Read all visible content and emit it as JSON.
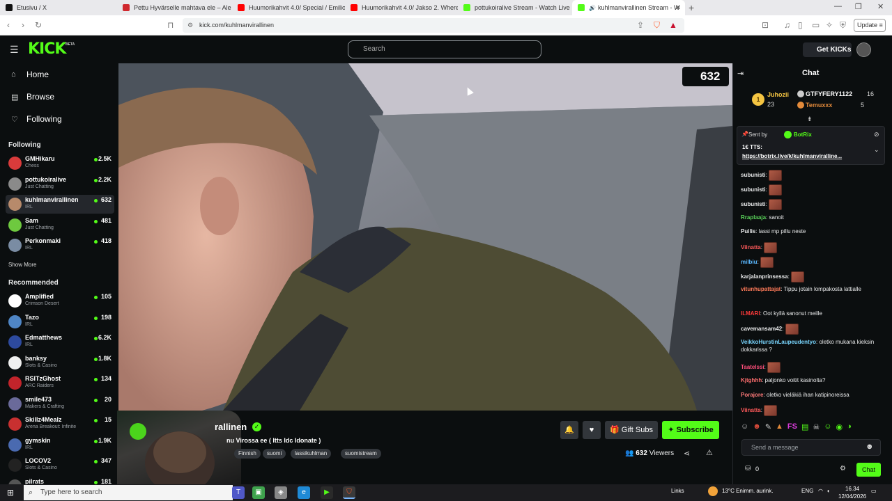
{
  "browser": {
    "tabs": [
      {
        "label": "Etusivu / X",
        "color": "#111111"
      },
      {
        "label": "Pettu Hyvärselle mahtava ele – Ale",
        "color": "#d0282e"
      },
      {
        "label": "Huumorikahvit 4.0/ Special / Emilio",
        "color": "#ff0000"
      },
      {
        "label": "Huumorikahvit 4.0/ Jakso 2. Where",
        "color": "#ff0000"
      },
      {
        "label": "pottukoiralive Stream - Watch Live o",
        "color": "#53fc18"
      },
      {
        "label": "kuhlmanvirallinen Stream - W",
        "color": "#53fc18"
      }
    ],
    "url": "kick.com/kuhlmanvirallinen",
    "update_label": "Update"
  },
  "header": {
    "logo": "KICK",
    "beta": "BETA",
    "search_placeholder": "Search",
    "get_kicks": "Get KICKs"
  },
  "sidebar": {
    "nav": [
      {
        "label": "Home",
        "icon": "home-icon"
      },
      {
        "label": "Browse",
        "icon": "browse-icon"
      },
      {
        "label": "Following",
        "icon": "heart-icon"
      }
    ],
    "following_title": "Following",
    "following": [
      {
        "name": "GMHikaru",
        "category": "Chess",
        "viewers": "2.5K",
        "color": "#d93b3b"
      },
      {
        "name": "pottukoiralive",
        "category": "Just Chatting",
        "viewers": "2.2K",
        "color": "#8a8a8a"
      },
      {
        "name": "kuhlmanvirallinen",
        "category": "IRL",
        "viewers": "632",
        "color": "#b78a6b"
      },
      {
        "name": "Sam",
        "category": "Just Chatting",
        "viewers": "481",
        "color": "#6ec93f"
      },
      {
        "name": "Perkonmaki",
        "category": "IRL",
        "viewers": "418",
        "color": "#7a8ca3"
      }
    ],
    "show_more": "Show More",
    "recommended_title": "Recommended",
    "recommended": [
      {
        "name": "Amplified",
        "category": "Crimson Desert",
        "viewers": "105",
        "color": "#ffffff"
      },
      {
        "name": "Tazo",
        "category": "IRL",
        "viewers": "198",
        "color": "#4f86c6"
      },
      {
        "name": "Edmatthews",
        "category": "IRL",
        "viewers": "6.2K",
        "color": "#2d4a9e"
      },
      {
        "name": "banksy",
        "category": "Slots & Casino",
        "viewers": "1.8K",
        "color": "#f0f0f0"
      },
      {
        "name": "RSITzGhost",
        "category": "ARC Raiders",
        "viewers": "134",
        "color": "#c2242b"
      },
      {
        "name": "smile473",
        "category": "Makers & Crafting",
        "viewers": "20",
        "color": "#6a6a9a"
      },
      {
        "name": "Skillz4Mealz",
        "category": "Arena Breakout: Infinite",
        "viewers": "15",
        "color": "#c83030"
      },
      {
        "name": "gymskin",
        "category": "IRL",
        "viewers": "1.9K",
        "color": "#4a6ab0"
      },
      {
        "name": "LOCOV2",
        "category": "Slots & Casino",
        "viewers": "347",
        "color": "#222222"
      },
      {
        "name": "pilrats",
        "category": "",
        "viewers": "181",
        "color": "#555555"
      }
    ]
  },
  "video": {
    "viewer_count": "632"
  },
  "stream": {
    "name": "rallinen",
    "title": "nu Virossa ee ( Itts Idc Idonate )",
    "tags": [
      "Finnish",
      "suomi",
      "lassikuhlman",
      "suomistream"
    ],
    "gift_subs": "Gift Subs",
    "subscribe": "Subscribe",
    "viewers": "632",
    "viewers_label": "Viewers"
  },
  "chat": {
    "title": "Chat",
    "gifters": [
      {
        "rank": "1",
        "name": "Juhozii",
        "count": "23"
      },
      {
        "name": "GTFYFERY1122",
        "count": "16"
      },
      {
        "name": "Temuxxx",
        "count": "5"
      }
    ],
    "pinned": {
      "sent_by": "Sent by",
      "bot": "BotRix",
      "tts": "1€ TTS:",
      "link": "https://botrix.live/k/kuhlmanviralline..."
    },
    "messages": [
      {
        "user": "subunisti",
        "text": "",
        "emote": true,
        "color": "#e9eaeb"
      },
      {
        "user": "subunisti",
        "text": "",
        "emote": true,
        "color": "#e9eaeb"
      },
      {
        "user": "subunisti",
        "text": "",
        "emote": true,
        "color": "#e9eaeb"
      },
      {
        "user": "Rraplaaja",
        "text": "sanoit",
        "emote": false,
        "color": "#5ad35a"
      },
      {
        "user": "Puilis",
        "text": "lassi mp pillu neste",
        "emote": false,
        "color": "#e9eaeb"
      },
      {
        "user": "Viinatta",
        "text": "",
        "emote": true,
        "color": "#ff5a5a"
      },
      {
        "user": "milbiu",
        "text": "",
        "emote": true,
        "color": "#5ab8ff"
      },
      {
        "user": "karjalanprinsessa",
        "text": "",
        "emote": true,
        "color": "#e9eaeb"
      },
      {
        "user": "vitunhupattajat",
        "text": "Tippu jotain lompakosta lattialle",
        "emote": false,
        "color": "#ff7a59"
      },
      {
        "user": "ILMARI",
        "text": "Oot kyllä sanonut meille",
        "emote": false,
        "color": "#ff3a3a"
      },
      {
        "user": "cavemansam42",
        "text": "",
        "emote": true,
        "color": "#e9eaeb"
      },
      {
        "user": "VeikkoHurstinLaupeudentyo",
        "text": "oletko mukana kieksin dokkarissa ?",
        "emote": false,
        "color": "#79d6ff"
      },
      {
        "user": "Taatelssi",
        "text": "",
        "emote": true,
        "color": "#ff4f7b"
      },
      {
        "user": "Kjtghhh",
        "text": "paljonko voitit kasinolta?",
        "emote": false,
        "color": "#ff6e6e"
      },
      {
        "user": "Porajore",
        "text": "oletko vieläkiä ihan katipinoreissa",
        "emote": false,
        "color": "#ff7a7a"
      },
      {
        "user": "Viinatta",
        "text": "",
        "emote": true,
        "color": "#ff5a5a"
      }
    ],
    "input_placeholder": "Send a message",
    "points": "0",
    "chat_button": "Chat"
  },
  "taskbar": {
    "search_placeholder": "Type here to search",
    "links": "Links",
    "weather": "13°C  Enimm. aurink.",
    "lang": "ENG",
    "time": "16.34",
    "date": "12/04/2026"
  }
}
